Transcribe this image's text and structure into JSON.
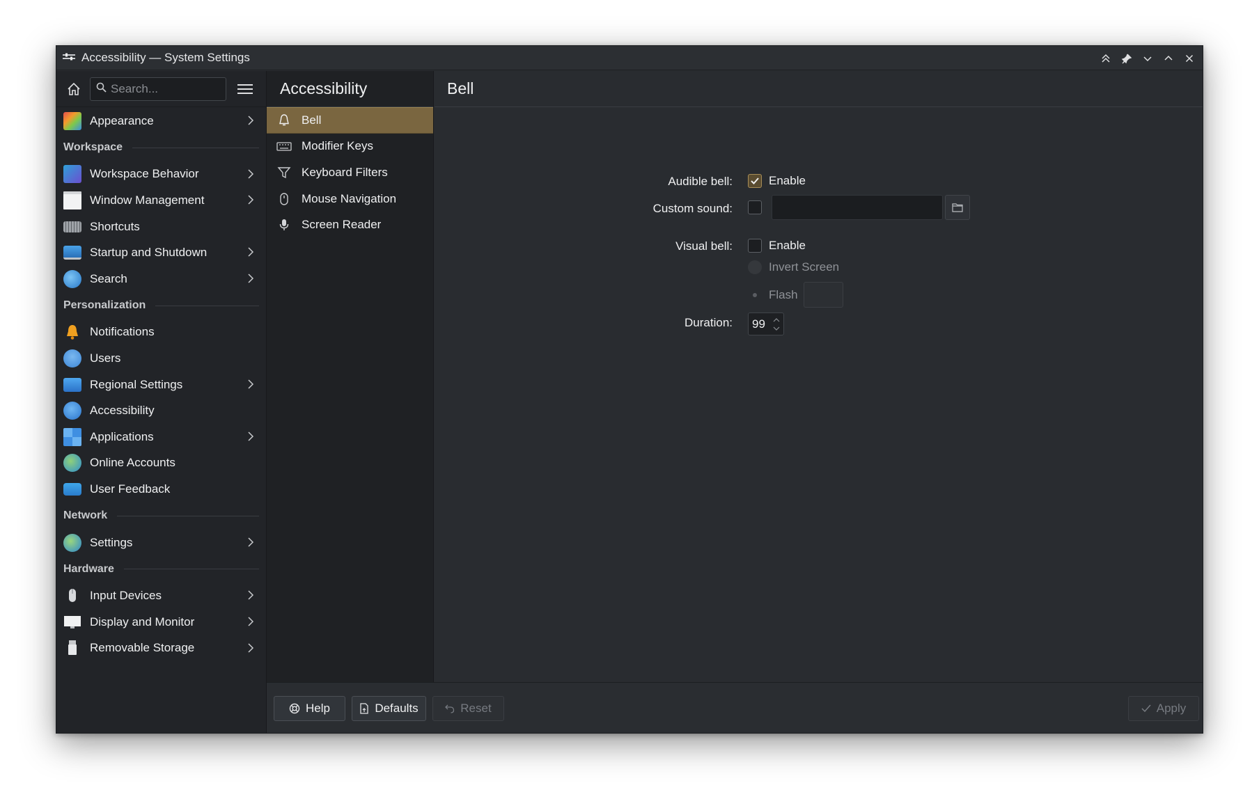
{
  "window": {
    "title": "Accessibility — System Settings"
  },
  "search": {
    "placeholder": "Search..."
  },
  "sidebar": {
    "top_items": [
      {
        "label": "Appearance",
        "icon": "appearance-icon",
        "chevron": true
      }
    ],
    "sections": [
      {
        "title": "Workspace",
        "items": [
          {
            "label": "Workspace Behavior",
            "icon": "workspace-behavior-icon",
            "chevron": true
          },
          {
            "label": "Window Management",
            "icon": "window-management-icon",
            "chevron": true
          },
          {
            "label": "Shortcuts",
            "icon": "keyboard-icon",
            "chevron": false
          },
          {
            "label": "Startup and Shutdown",
            "icon": "startup-icon",
            "chevron": true
          },
          {
            "label": "Search",
            "icon": "search-globe-icon",
            "chevron": true
          }
        ]
      },
      {
        "title": "Personalization",
        "items": [
          {
            "label": "Notifications",
            "icon": "bell-icon",
            "chevron": false
          },
          {
            "label": "Users",
            "icon": "users-icon",
            "chevron": false
          },
          {
            "label": "Regional Settings",
            "icon": "regional-icon",
            "chevron": true
          },
          {
            "label": "Accessibility",
            "icon": "accessibility-icon",
            "chevron": false
          },
          {
            "label": "Applications",
            "icon": "applications-icon",
            "chevron": true
          },
          {
            "label": "Online Accounts",
            "icon": "online-accounts-icon",
            "chevron": false
          },
          {
            "label": "User Feedback",
            "icon": "feedback-icon",
            "chevron": false
          }
        ]
      },
      {
        "title": "Network",
        "items": [
          {
            "label": "Settings",
            "icon": "network-globe-icon",
            "chevron": true
          }
        ]
      },
      {
        "title": "Hardware",
        "items": [
          {
            "label": "Input Devices",
            "icon": "mouse-icon",
            "chevron": true
          },
          {
            "label": "Display and Monitor",
            "icon": "monitor-icon",
            "chevron": true
          },
          {
            "label": "Removable Storage",
            "icon": "usb-icon",
            "chevron": true
          }
        ]
      }
    ]
  },
  "middle": {
    "title": "Accessibility",
    "items": [
      {
        "label": "Bell",
        "icon": "bell-outline-icon",
        "active": true
      },
      {
        "label": "Modifier Keys",
        "icon": "keyboard-outline-icon",
        "active": false
      },
      {
        "label": "Keyboard Filters",
        "icon": "filter-icon",
        "active": false
      },
      {
        "label": "Mouse Navigation",
        "icon": "mouse-outline-icon",
        "active": false
      },
      {
        "label": "Screen Reader",
        "icon": "microphone-icon",
        "active": false
      }
    ]
  },
  "main": {
    "title": "Bell",
    "audible_bell_label": "Audible bell:",
    "audible_enable_label": "Enable",
    "audible_enabled": true,
    "custom_sound_label": "Custom sound:",
    "custom_sound_enabled": false,
    "custom_sound_value": "",
    "visual_bell_label": "Visual bell:",
    "visual_enable_label": "Enable",
    "visual_enabled": false,
    "invert_screen_label": "Invert Screen",
    "flash_label": "Flash",
    "duration_label": "Duration:",
    "duration_value": "99"
  },
  "footer": {
    "help_label": "Help",
    "defaults_label": "Defaults",
    "reset_label": "Reset",
    "apply_label": "Apply"
  },
  "colors": {
    "accent": "#7a6640",
    "checkbox_checked": "#a88e58"
  }
}
